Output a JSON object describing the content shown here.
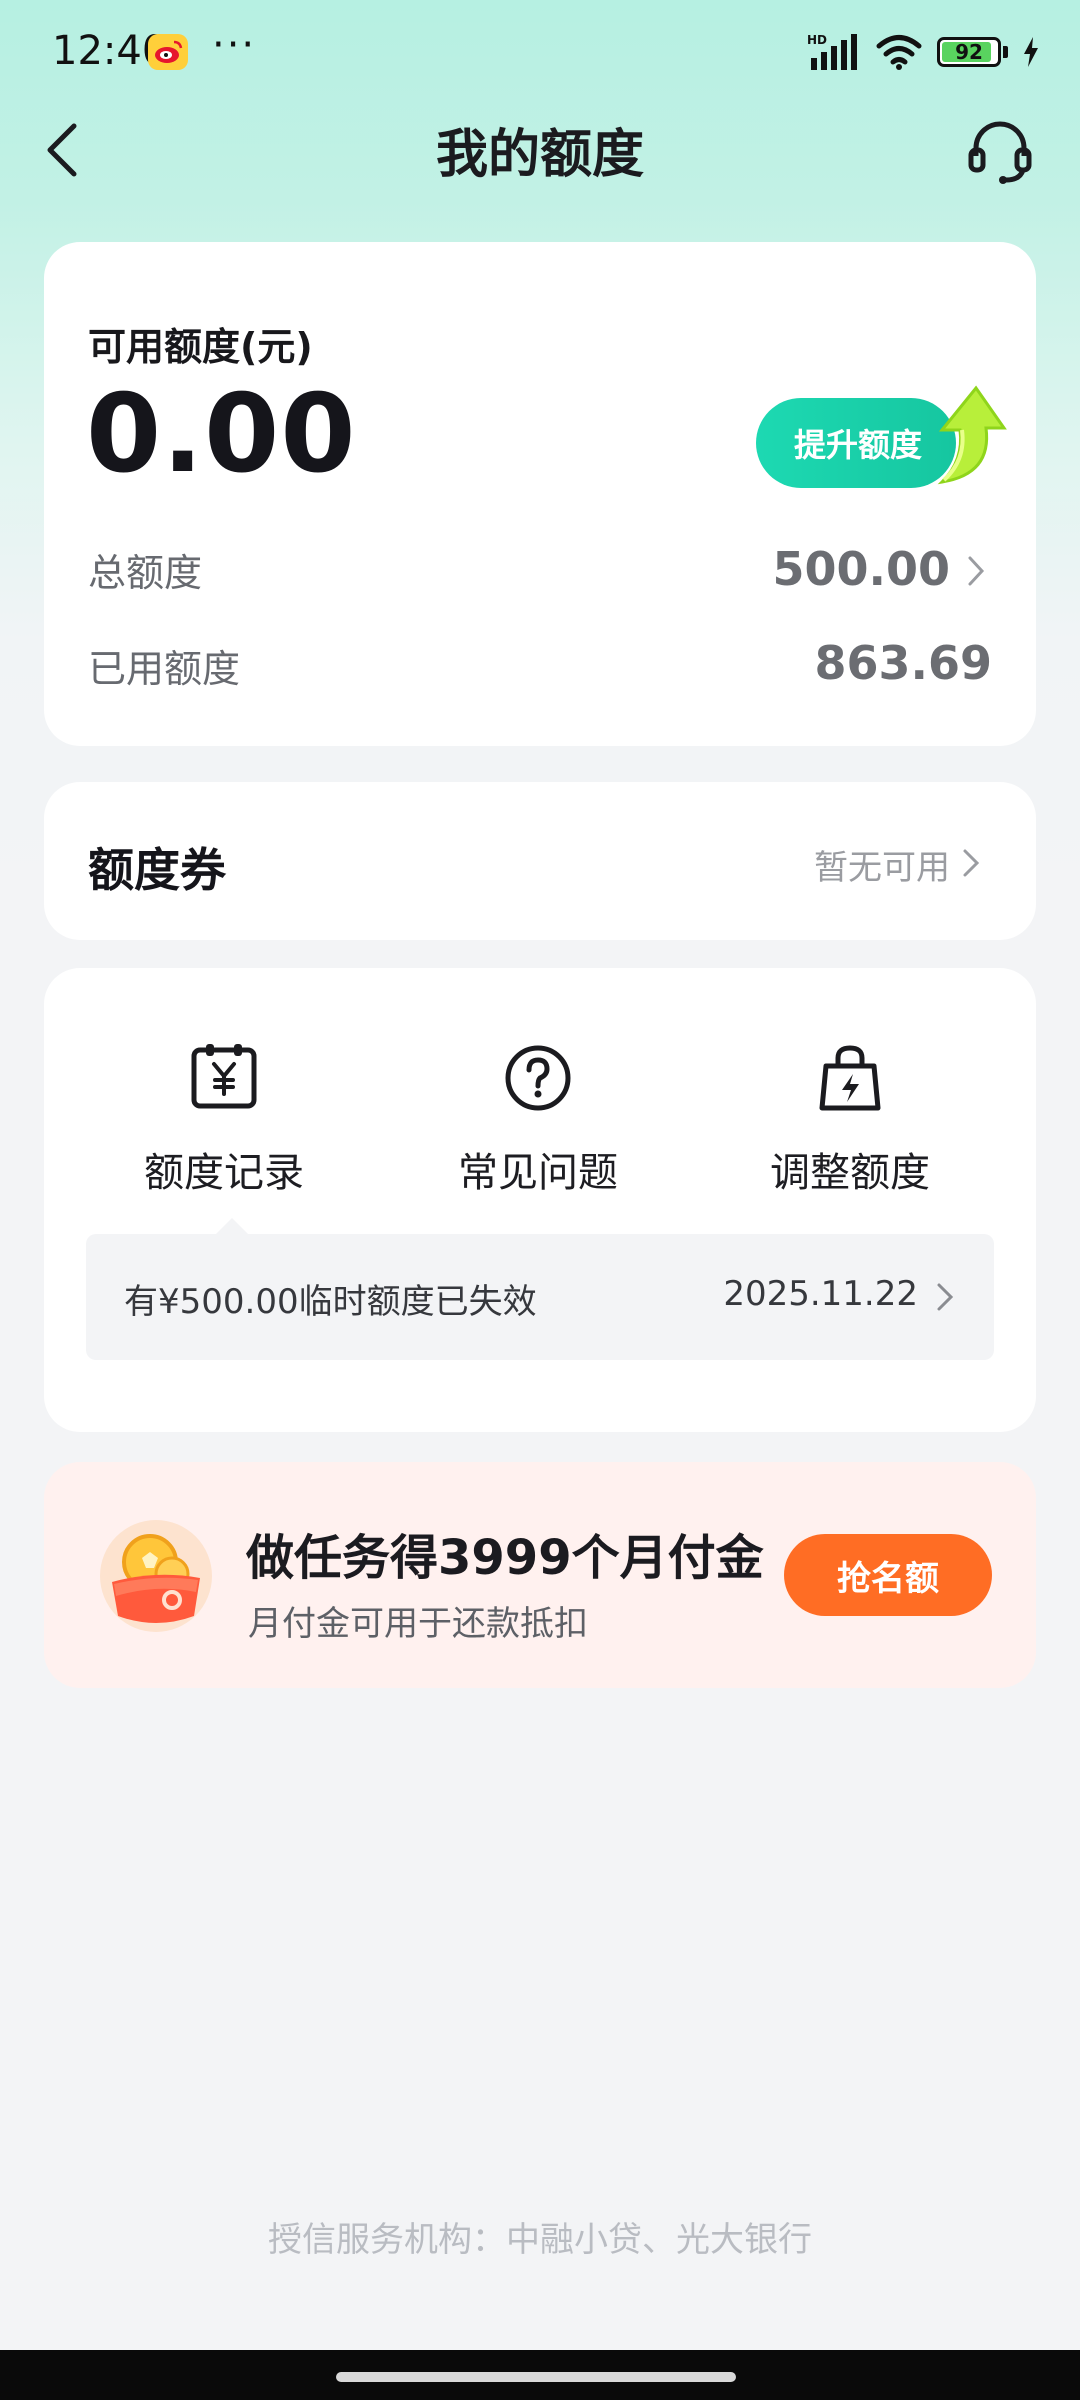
{
  "status_bar": {
    "time": "12:40",
    "dots": "···",
    "battery_percent": "92",
    "network_badge": "HD",
    "icons": [
      "weibo-icon",
      "signal-icon",
      "wifi-icon",
      "battery-icon",
      "charging-icon"
    ]
  },
  "header": {
    "title": "我的额度",
    "back_icon": "chevron-left-icon",
    "service_icon": "headset-icon"
  },
  "credit": {
    "available_label": "可用额度(元)",
    "available_amount": "0.00",
    "raise_button": "提升额度",
    "total_label": "总额度",
    "total_value": "500.00",
    "used_label": "已用额度",
    "used_value": "863.69"
  },
  "coupon": {
    "title": "额度券",
    "status": "暂无可用"
  },
  "menu": {
    "items": [
      {
        "label": "额度记录",
        "icon": "yuan-record-icon"
      },
      {
        "label": "常见问题",
        "icon": "question-icon"
      },
      {
        "label": "调整额度",
        "icon": "bag-lightning-icon"
      }
    ],
    "notice_text": "有¥500.00临时额度已失效",
    "notice_date": "2025.11.22"
  },
  "task": {
    "title": "做任务得3999个月付金",
    "subtitle": "月付金可用于还款抵扣",
    "button": "抢名额",
    "icon": "coin-pouch-icon"
  },
  "footer": {
    "text": "授信服务机构：中融小贷、光大银行"
  },
  "colors": {
    "accent_green": "#16c6a0",
    "accent_orange": "#ff6d24",
    "header_mint": "#b6f0e2"
  }
}
